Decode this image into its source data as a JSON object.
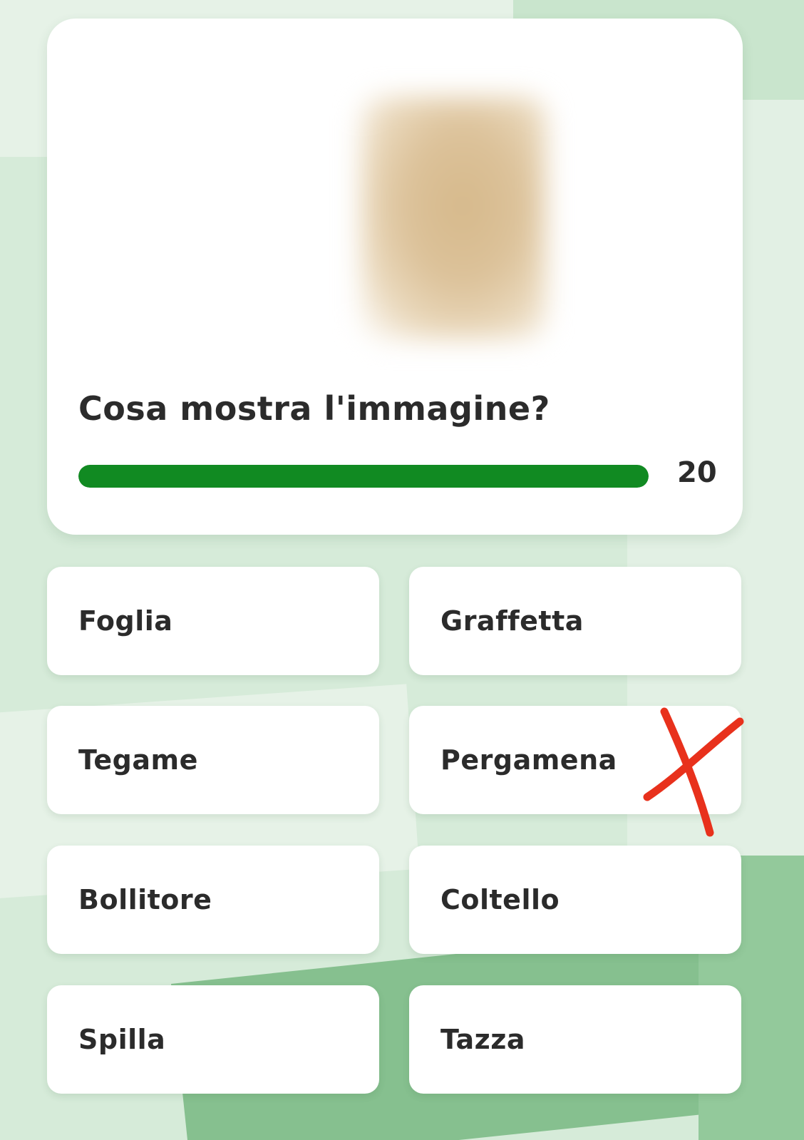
{
  "question": {
    "text": "Cosa mostra l'immagine?",
    "timer_value": "20",
    "progress_fraction": 1.0
  },
  "answers": [
    {
      "label": "Foglia"
    },
    {
      "label": "Graffetta"
    },
    {
      "label": "Tegame"
    },
    {
      "label": "Pergamena"
    },
    {
      "label": "Bollitore"
    },
    {
      "label": "Coltello"
    },
    {
      "label": "Spilla"
    },
    {
      "label": "Tazza"
    }
  ],
  "colors": {
    "progress": "#118a22",
    "wrong_mark": "#e8311c",
    "background": "#d6ebd9"
  },
  "icons": {
    "marked_answer": "red-x-mark-icon"
  }
}
